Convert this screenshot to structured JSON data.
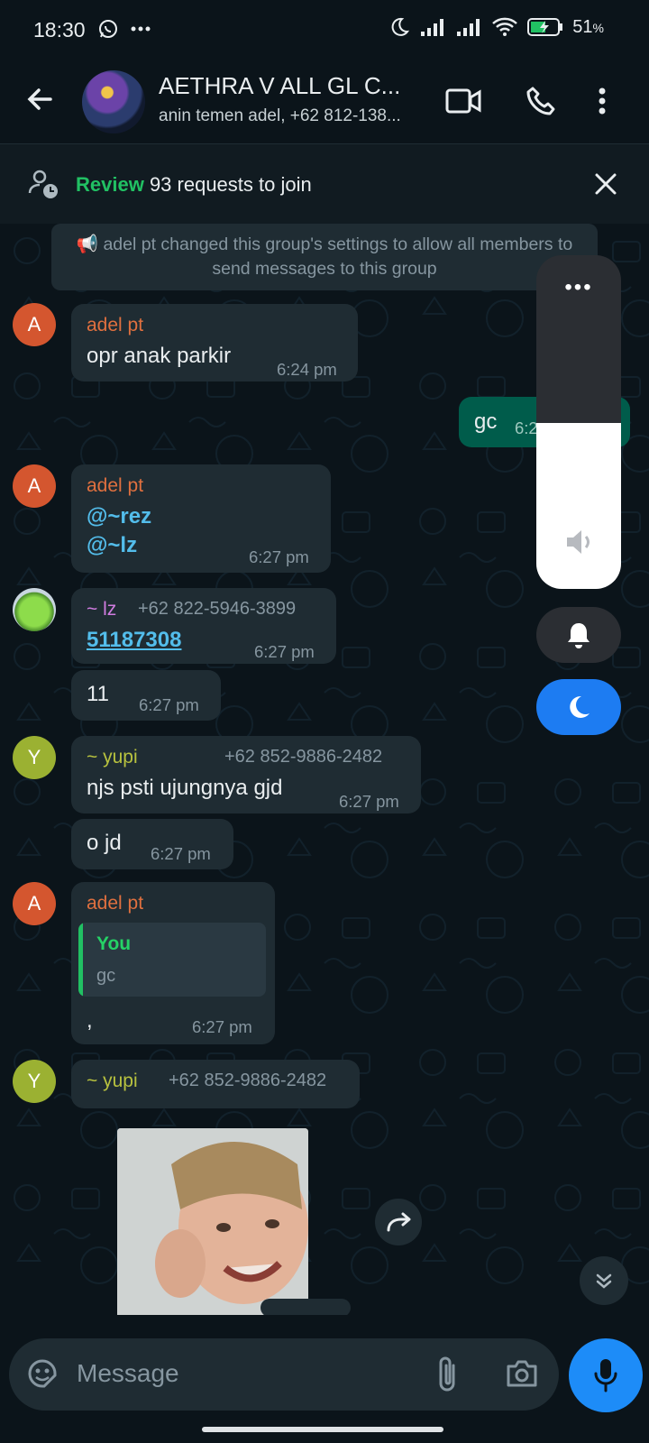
{
  "status_bar": {
    "time": "18:30",
    "battery_pct": "51",
    "battery_unit": "%"
  },
  "header": {
    "title": "AETHRA V ALL GL C...",
    "subtitle": "anin temen adel, +62 812-138..."
  },
  "review_bar": {
    "link": "Review",
    "text": " 93 requests to join"
  },
  "system_message": "📢 adel pt changed this group's settings to allow all members to send messages to this group",
  "messages": [
    {
      "sender": "adel pt",
      "avatar_letter": "A",
      "text": "opr anak parkir",
      "time": "6:24 pm"
    },
    {
      "text": "gc",
      "time": "6:2"
    },
    {
      "sender": "adel pt",
      "avatar_letter": "A",
      "line1": "@~rez",
      "line2": "@~lz",
      "time": "6:27 pm"
    },
    {
      "sender": "~ lz",
      "phone": "+62 822-5946-3899",
      "text": "51187308",
      "time": "6:27 pm"
    },
    {
      "text": "11",
      "time": "6:27 pm"
    },
    {
      "sender": "~ yupi",
      "avatar_letter": "Y",
      "phone": "+62 852-9886-2482",
      "text": "njs psti ujungnya gjd",
      "time": "6:27 pm"
    },
    {
      "text": "o jd",
      "time": "6:27 pm"
    },
    {
      "sender": "adel pt",
      "avatar_letter": "A",
      "quote_name": "You",
      "quote_text": "gc",
      "text": ",",
      "time": "6:27 pm"
    },
    {
      "sender": "~ yupi",
      "avatar_letter": "Y",
      "phone": "+62 852-9886-2482"
    }
  ],
  "volume": {
    "level": 0.497
  },
  "input": {
    "placeholder": "Message"
  },
  "colors": {
    "accent_green": "#21c063",
    "sender_adel": "#e0703f",
    "sender_lz": "#d07ce0",
    "sender_yupi": "#b8c23f",
    "avatar_adel": "#d4562f",
    "avatar_yupi": "#9bb132",
    "mic_blue": "#1d8cf8"
  }
}
